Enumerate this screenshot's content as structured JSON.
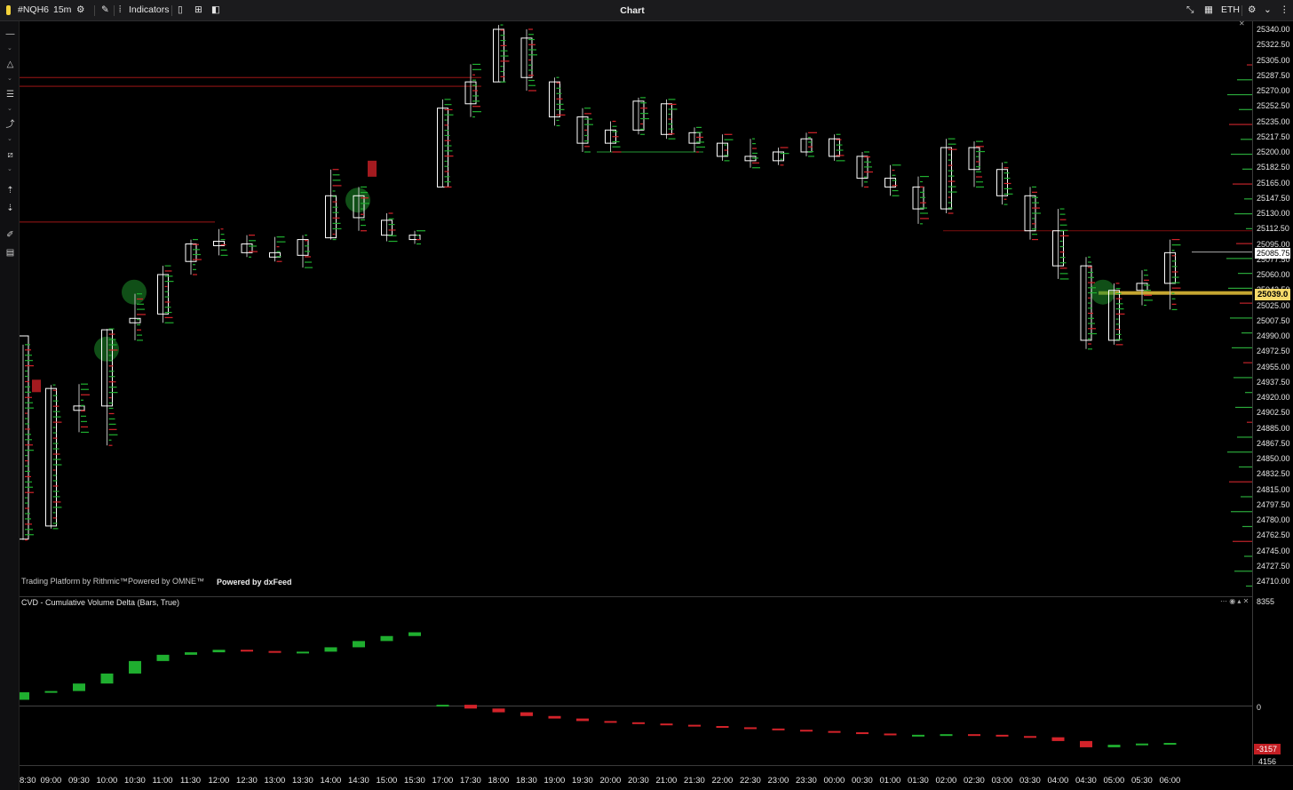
{
  "toolbar": {
    "symbol": "#NQH6",
    "timeframe": "15m",
    "indicators_label": "Indicators",
    "title": "Chart",
    "session": "ETH"
  },
  "price_axis": {
    "labels": [
      "25340.00",
      "25322.50",
      "25305.00",
      "25287.50",
      "25270.00",
      "25252.50",
      "25235.00",
      "25217.50",
      "25200.00",
      "25182.50",
      "25165.00",
      "25147.50",
      "25130.00",
      "25112.50",
      "25095.00",
      "25077.50",
      "25060.00",
      "25042.50",
      "25025.00",
      "25007.50",
      "24990.00",
      "24972.50",
      "24955.00",
      "24937.50",
      "24920.00",
      "24902.50",
      "24885.00",
      "24867.50",
      "24850.00",
      "24832.50",
      "24815.00",
      "24797.50",
      "24780.00",
      "24762.50",
      "24745.00",
      "24727.50",
      "24710.00"
    ],
    "last_price": "25085.75",
    "marker_price": "25039.0",
    "colors": {
      "last_price_bg": "#ffffff",
      "marker_bg": "#f5d96b"
    }
  },
  "cvd": {
    "title": "CVD - Cumulative Volume Delta (Bars, True)",
    "scale_top": "8355",
    "scale_zero": "0",
    "current_value": "-3157",
    "bottom_value": "4156"
  },
  "time_axis": {
    "labels": [
      "8:30",
      "09:00",
      "09:30",
      "10:00",
      "10:30",
      "11:00",
      "11:30",
      "12:00",
      "12:30",
      "13:00",
      "13:30",
      "14:00",
      "14:30",
      "15:00",
      "15:30",
      "17:00",
      "17:30",
      "18:00",
      "18:30",
      "19:00",
      "19:30",
      "20:00",
      "20:30",
      "21:00",
      "21:30",
      "22:00",
      "22:30",
      "23:00",
      "23:30",
      "00:00",
      "00:30",
      "01:00",
      "01:30",
      "02:00",
      "02:30",
      "03:00",
      "03:30",
      "04:00",
      "04:30",
      "05:00",
      "05:30",
      "06:00"
    ]
  },
  "watermark": {
    "rithmic": "Trading Platform by Rithmic™",
    "omne": "Powered by OMNE™",
    "dxfeed": "Powered by dxFeed"
  },
  "chart_data": {
    "type": "candlestick-footprint",
    "colors": {
      "up": "#1fae2f",
      "down": "#d3232a",
      "candle_outline": "#ffffff"
    },
    "candles": [
      [
        "8:30",
        24990,
        24980,
        24757,
        24758
      ],
      [
        "09:00",
        24930,
        24934,
        24770,
        24773
      ],
      [
        "09:30",
        24905,
        24935,
        24880,
        24910
      ],
      [
        "10:00",
        24910,
        24998,
        24865,
        24997
      ],
      [
        "10:30",
        25005,
        25038,
        24985,
        25010
      ],
      [
        "11:00",
        25015,
        25070,
        25005,
        25060
      ],
      [
        "11:30",
        25075,
        25100,
        25060,
        25095
      ],
      [
        "12:00",
        25098,
        25112,
        25082,
        25093
      ],
      [
        "12:30",
        25095,
        25105,
        25080,
        25085
      ],
      [
        "13:00",
        25085,
        25103,
        25075,
        25080
      ],
      [
        "13:30",
        25082,
        25105,
        25068,
        25100
      ],
      [
        "14:00",
        25102,
        25180,
        25100,
        25150
      ],
      [
        "14:30",
        25150,
        25160,
        25110,
        25125
      ],
      [
        "15:00",
        25122,
        25130,
        25098,
        25105
      ],
      [
        "15:30",
        25105,
        25110,
        25095,
        25100
      ],
      [
        "17:00",
        25160,
        25260,
        25160,
        25250
      ],
      [
        "17:30",
        25255,
        25300,
        25240,
        25280
      ],
      [
        "18:00",
        25280,
        25345,
        25280,
        25340
      ],
      [
        "18:30",
        25330,
        25340,
        25270,
        25285
      ],
      [
        "19:00",
        25280,
        25285,
        25230,
        25240
      ],
      [
        "19:30",
        25240,
        25250,
        25200,
        25210
      ],
      [
        "20:00",
        25210,
        25235,
        25200,
        25225
      ],
      [
        "20:30",
        25225,
        25262,
        25220,
        25258
      ],
      [
        "21:00",
        25255,
        25260,
        25215,
        25220
      ],
      [
        "21:30",
        25222,
        25228,
        25200,
        25210
      ],
      [
        "22:00",
        25210,
        25220,
        25190,
        25195
      ],
      [
        "22:30",
        25195,
        25215,
        25182,
        25190
      ],
      [
        "23:00",
        25190,
        25205,
        25185,
        25200
      ],
      [
        "23:30",
        25200,
        25222,
        25195,
        25215
      ],
      [
        "00:00",
        25215,
        25220,
        25190,
        25195
      ],
      [
        "00:30",
        25195,
        25200,
        25160,
        25170
      ],
      [
        "01:00",
        25170,
        25185,
        25150,
        25160
      ],
      [
        "01:30",
        25160,
        25172,
        25118,
        25135
      ],
      [
        "02:00",
        25135,
        25215,
        25130,
        25205
      ],
      [
        "02:30",
        25205,
        25212,
        25160,
        25180
      ],
      [
        "03:00",
        25180,
        25188,
        25140,
        25150
      ],
      [
        "03:30",
        25150,
        25160,
        25100,
        25110
      ],
      [
        "04:00",
        25110,
        25135,
        25055,
        25070
      ],
      [
        "04:30",
        25070,
        25080,
        24975,
        24985
      ],
      [
        "05:00",
        24985,
        25050,
        24980,
        25042
      ],
      [
        "05:30",
        25042,
        25065,
        25025,
        25050
      ],
      [
        "06:00",
        25050,
        25100,
        25020,
        25085
      ]
    ],
    "cvd_values": [
      1100,
      1200,
      1800,
      2600,
      3600,
      4100,
      4300,
      4500,
      4400,
      4300,
      4350,
      4700,
      5200,
      5600,
      5900,
      100,
      -200,
      -500,
      -800,
      -1000,
      -1200,
      -1300,
      -1400,
      -1500,
      -1600,
      -1700,
      -1800,
      -1900,
      -2000,
      -2100,
      -2200,
      -2300,
      -2300,
      -2250,
      -2300,
      -2400,
      -2500,
      -2800,
      -3300,
      -3100,
      -3000,
      -2950
    ],
    "price_range": [
      24700,
      25350
    ],
    "cvd_range": [
      -4300,
      8355
    ],
    "levels": [
      {
        "price": 25285,
        "color": "#b01818"
      },
      {
        "price": 25275,
        "color": "#b01818"
      },
      {
        "price": 25120,
        "color": "#b01818"
      },
      {
        "price": 25110,
        "color": "#8a1010"
      },
      {
        "price": 25200,
        "color": "#29a83a"
      },
      {
        "price": 25039,
        "color": "#e8c33a"
      }
    ]
  }
}
